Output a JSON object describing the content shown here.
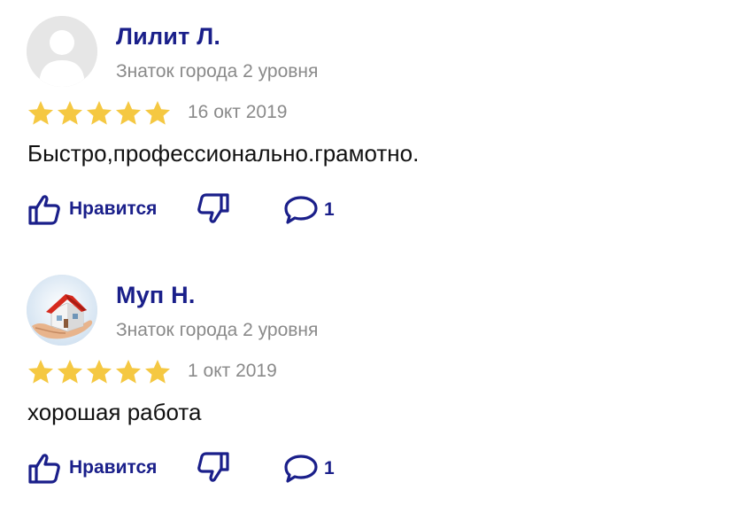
{
  "colors": {
    "accent": "#1a1f8a",
    "star": "#f5c842",
    "muted": "#8a8a8a"
  },
  "reviews": [
    {
      "author": "Лилит Л.",
      "level": "Знаток города 2 уровня",
      "rating": 5,
      "date": "16 окт 2019",
      "text": "Быстро,профессионально.грамотно.",
      "like_label": "Нравится",
      "comments": "1",
      "avatar": "default-user-avatar"
    },
    {
      "author": "Муп Н.",
      "level": "Знаток города 2 уровня",
      "rating": 5,
      "date": "1 окт 2019",
      "text": "хорошая работа",
      "like_label": "Нравится",
      "comments": "1",
      "avatar": "house-in-hands-avatar"
    }
  ]
}
